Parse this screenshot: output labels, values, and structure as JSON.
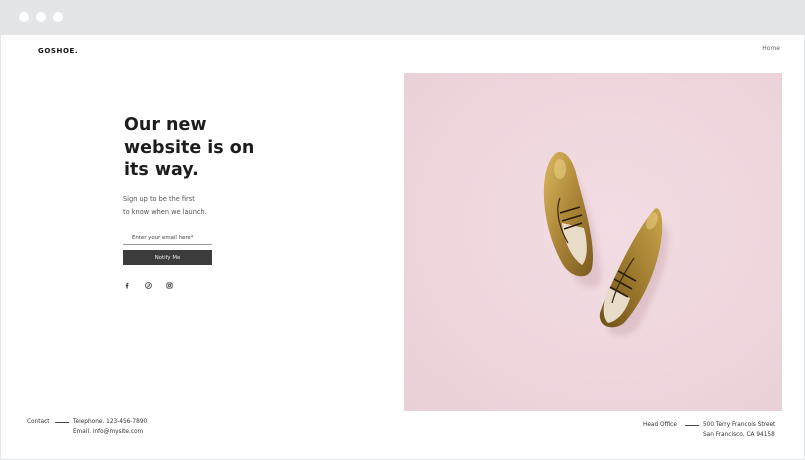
{
  "header": {
    "logo": "GOSHOE.",
    "nav_home": "Home"
  },
  "hero": {
    "headline": "Our new\nwebsite is on\nits way.",
    "subtext": "Sign up to be the first\nto know when we launch.",
    "email_placeholder": "Enter your email here*",
    "notify_label": "Notify Me",
    "image_description": "pair of gold metallic oxford shoes on pink background",
    "background_color": "#efd6dd"
  },
  "social": {
    "icons": [
      "facebook-icon",
      "pinterest-icon",
      "instagram-icon"
    ]
  },
  "footer": {
    "contact_label": "Contact",
    "telephone": "Telephone. 123-456-7890",
    "email": "Email. info@mysite.com",
    "office_label": "Head Office",
    "address_line1": "500 Terry Francois Street",
    "address_line2": "San Francisco, CA 94158"
  },
  "colors": {
    "button_bg": "#3c3c3c",
    "accent_gold": "#b08a3a",
    "chrome_bg": "#e4e5e7"
  }
}
